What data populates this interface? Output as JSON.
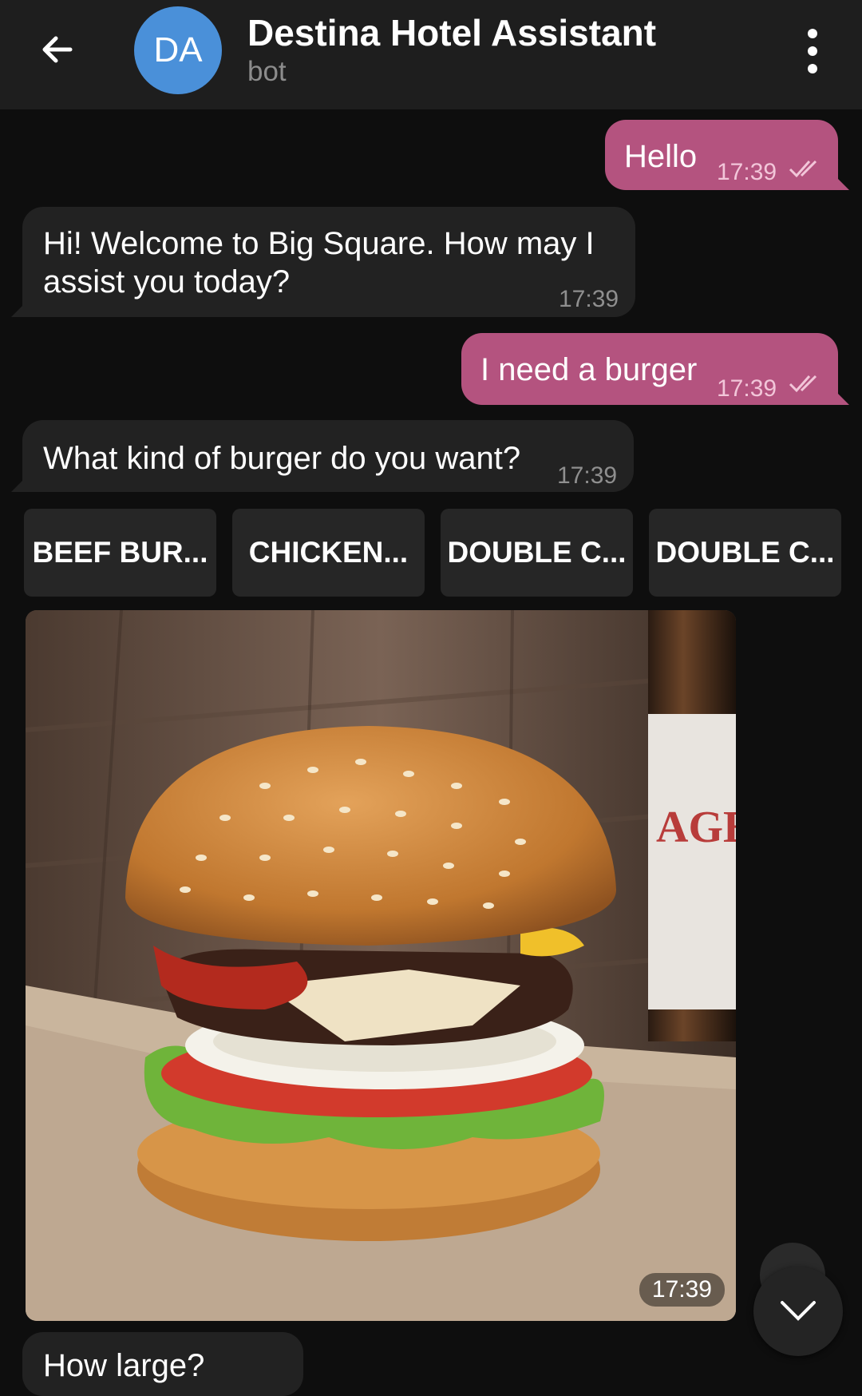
{
  "header": {
    "avatar_initials": "DA",
    "title": "Destina Hotel Assistant",
    "subtitle": "bot"
  },
  "messages": [
    {
      "direction": "out",
      "text": "Hello",
      "time": "17:39",
      "read": true
    },
    {
      "direction": "in",
      "text": "Hi! Welcome to Big Square. How may I assist you today?",
      "time": "17:39"
    },
    {
      "direction": "out",
      "text": "I need a burger",
      "time": "17:39",
      "read": true
    },
    {
      "direction": "in",
      "text": "What kind of burger do you want?",
      "time": "17:39"
    }
  ],
  "keyboard_buttons": [
    "BEEF BUR...",
    "CHICKEN...",
    "DOUBLE C...",
    "DOUBLE C..."
  ],
  "photo": {
    "time": "17:39",
    "bottle_label": "LAGER ORIGINAL"
  },
  "next_message_partial": "How large?",
  "colors": {
    "outgoing": "#b4537f",
    "incoming": "#222222",
    "header": "#1e1e1e",
    "avatar": "#4a90d9"
  }
}
